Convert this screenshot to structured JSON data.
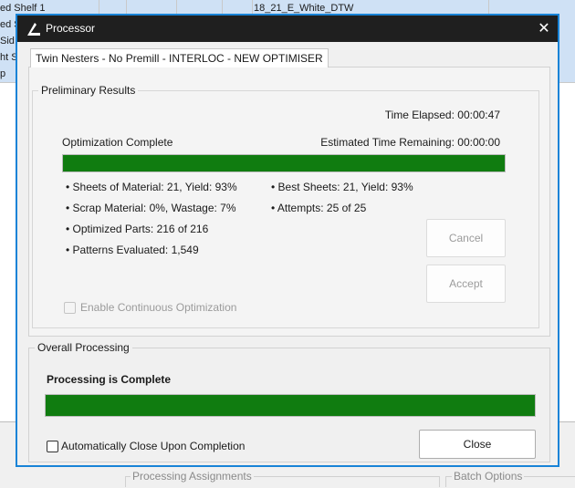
{
  "background": {
    "rows": [
      {
        "c1": "ed Shelf 1",
        "c2": "",
        "c3": "",
        "c4": "",
        "c5": "18_21_E_White_DTW"
      },
      {
        "c1": "ed S",
        "c2": "",
        "c3": "",
        "c4": "",
        "c5": ""
      },
      {
        "c1": "Sid",
        "c2": "",
        "c3": "",
        "c4": "",
        "c5": ""
      },
      {
        "c1": "ht S",
        "c2": "",
        "c3": "",
        "c4": "",
        "c5": ""
      },
      {
        "c1": "p",
        "c2": "",
        "c3": "",
        "c4": "",
        "c5": ""
      }
    ],
    "groups": {
      "processing_assignments": "Processing Assignments",
      "batch_options": "Batch Options"
    }
  },
  "dialog": {
    "title": "Processor",
    "close_symbol": "✕",
    "tab_label": "Twin Nesters - No Premill - INTERLOC - NEW OPTIMISER",
    "preliminary": {
      "legend": "Preliminary Results",
      "time_elapsed": "Time Elapsed: 00:00:47",
      "status": "Optimization Complete",
      "estimated_remaining": "Estimated Time Remaining: 00:00:00",
      "progress_percent": 100,
      "stats_left": [
        "• Sheets of Material: 21, Yield: 93%",
        "• Scrap Material: 0%, Wastage: 7%",
        "• Optimized Parts: 216 of 216",
        "• Patterns Evaluated: 1,549"
      ],
      "stats_right": [
        "• Best Sheets: 21, Yield: 93%",
        "• Attempts: 25 of 25"
      ],
      "cancel_label": "Cancel",
      "accept_label": "Accept",
      "continuous_label": "Enable Continuous Optimization"
    },
    "overall": {
      "legend": "Overall Processing",
      "status": "Processing is Complete",
      "progress_percent": 100,
      "auto_close_label": "Automatically Close Upon Completion",
      "close_label": "Close"
    }
  },
  "colors": {
    "accent_border": "#1883d7",
    "progress_green": "#107c10",
    "titlebar": "#1f1f1f"
  }
}
